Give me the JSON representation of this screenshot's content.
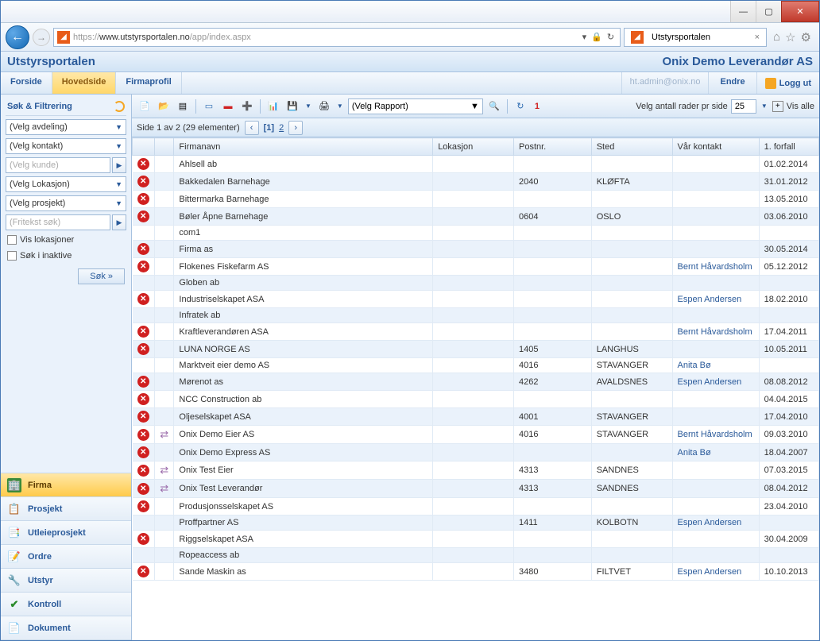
{
  "window": {
    "url_prefix": "https://",
    "url_host": "www.utstyrsportalen.no",
    "url_path": "/app/index.aspx",
    "tab_title": "Utstyrsportalen"
  },
  "header": {
    "app_title": "Utstyrsportalen",
    "company": "Onix Demo Leverandør AS"
  },
  "menu": {
    "items": [
      "Forside",
      "Hovedside",
      "Firmaprofil"
    ],
    "active_index": 1,
    "user_email": "ht.admin@onix.no",
    "endre": "Endre",
    "logout": "Logg ut"
  },
  "filter": {
    "title": "Søk & Filtrering",
    "avdeling": "(Velg avdeling)",
    "kontakt": "(Velg kontakt)",
    "kunde": "(Velg kunde)",
    "lokasjon": "(Velg Lokasjon)",
    "prosjekt": "(Velg prosjekt)",
    "fritekst": "(Fritekst søk)",
    "vis_lokasjoner": "Vis lokasjoner",
    "sok_inaktive": "Søk i inaktive",
    "sok_btn": "Søk »"
  },
  "nav": {
    "items": [
      {
        "label": "Firma",
        "icon": "🏢",
        "cls": "ico-firma"
      },
      {
        "label": "Prosjekt",
        "icon": "📋",
        "cls": "ico-blue"
      },
      {
        "label": "Utleieprosjekt",
        "icon": "📑",
        "cls": "ico-blue"
      },
      {
        "label": "Ordre",
        "icon": "📝",
        "cls": "ico-blue"
      },
      {
        "label": "Utstyr",
        "icon": "🔧",
        "cls": "ico-green"
      },
      {
        "label": "Kontroll",
        "icon": "✔",
        "cls": "ico-green"
      },
      {
        "label": "Dokument",
        "icon": "📄",
        "cls": "ico-blue"
      }
    ],
    "active_index": 0
  },
  "toolbar": {
    "report_placeholder": "(Velg Rapport)",
    "count": "1",
    "rows_label": "Velg antall rader pr side",
    "rows_value": "25",
    "vis_alle": "Vis alle"
  },
  "pager": {
    "summary": "Side 1 av 2 (29 elementer)",
    "current": "[1]",
    "next": "2"
  },
  "columns": {
    "firmanavn": "Firmanavn",
    "lokasjon": "Lokasjon",
    "postnr": "Postnr.",
    "sted": "Sted",
    "kontakt": "Vår kontakt",
    "forfall": "1. forfall"
  },
  "rows": [
    {
      "del": true,
      "swap": false,
      "name": "Ahlsell ab",
      "lok": "",
      "post": "",
      "sted": "",
      "kontakt": "",
      "forfall": "01.02.2014"
    },
    {
      "del": true,
      "swap": false,
      "name": "Bakkedalen Barnehage",
      "lok": "",
      "post": "2040",
      "sted": "KLØFTA",
      "kontakt": "",
      "forfall": "31.01.2012"
    },
    {
      "del": true,
      "swap": false,
      "name": "Bittermarka Barnehage",
      "lok": "",
      "post": "",
      "sted": "",
      "kontakt": "",
      "forfall": "13.05.2010"
    },
    {
      "del": true,
      "swap": false,
      "name": "Bøler Åpne Barnehage",
      "lok": "",
      "post": "0604",
      "sted": "OSLO",
      "kontakt": "",
      "forfall": "03.06.2010"
    },
    {
      "del": false,
      "swap": false,
      "name": "com1",
      "lok": "",
      "post": "",
      "sted": "",
      "kontakt": "",
      "forfall": ""
    },
    {
      "del": true,
      "swap": false,
      "name": "Firma as",
      "lok": "",
      "post": "",
      "sted": "",
      "kontakt": "",
      "forfall": "30.05.2014"
    },
    {
      "del": true,
      "swap": false,
      "name": "Flokenes Fiskefarm AS",
      "lok": "",
      "post": "",
      "sted": "",
      "kontakt": "Bernt Håvardsholm",
      "forfall": "05.12.2012"
    },
    {
      "del": false,
      "swap": false,
      "name": "Globen ab",
      "lok": "",
      "post": "",
      "sted": "",
      "kontakt": "",
      "forfall": ""
    },
    {
      "del": true,
      "swap": false,
      "name": "Industriselskapet ASA",
      "lok": "",
      "post": "",
      "sted": "",
      "kontakt": "Espen Andersen",
      "forfall": "18.02.2010"
    },
    {
      "del": false,
      "swap": false,
      "name": "Infratek ab",
      "lok": "",
      "post": "",
      "sted": "",
      "kontakt": "",
      "forfall": ""
    },
    {
      "del": true,
      "swap": false,
      "name": "Kraftleverandøren ASA",
      "lok": "",
      "post": "",
      "sted": "",
      "kontakt": "Bernt Håvardsholm",
      "forfall": "17.04.2011"
    },
    {
      "del": true,
      "swap": false,
      "name": "LUNA NORGE AS",
      "lok": "",
      "post": "1405",
      "sted": "LANGHUS",
      "kontakt": "",
      "forfall": "10.05.2011"
    },
    {
      "del": false,
      "swap": false,
      "name": "Marktveit eier demo AS",
      "lok": "",
      "post": "4016",
      "sted": "STAVANGER",
      "kontakt": "Anita Bø",
      "forfall": ""
    },
    {
      "del": true,
      "swap": false,
      "name": "Mørenot as",
      "lok": "",
      "post": "4262",
      "sted": "AVALDSNES",
      "kontakt": "Espen Andersen",
      "forfall": "08.08.2012"
    },
    {
      "del": true,
      "swap": false,
      "name": "NCC Construction ab",
      "lok": "",
      "post": "",
      "sted": "",
      "kontakt": "",
      "forfall": "04.04.2015"
    },
    {
      "del": true,
      "swap": false,
      "name": "Oljeselskapet ASA",
      "lok": "",
      "post": "4001",
      "sted": "STAVANGER",
      "kontakt": "",
      "forfall": "17.04.2010"
    },
    {
      "del": true,
      "swap": true,
      "name": "Onix Demo Eier AS",
      "lok": "",
      "post": "4016",
      "sted": "STAVANGER",
      "kontakt": "Bernt Håvardsholm",
      "forfall": "09.03.2010"
    },
    {
      "del": true,
      "swap": false,
      "name": "Onix Demo Express AS",
      "lok": "",
      "post": "",
      "sted": "",
      "kontakt": "Anita Bø",
      "forfall": "18.04.2007"
    },
    {
      "del": true,
      "swap": true,
      "name": "Onix Test Eier",
      "lok": "",
      "post": "4313",
      "sted": "SANDNES",
      "kontakt": "",
      "forfall": "07.03.2015"
    },
    {
      "del": true,
      "swap": true,
      "name": "Onix Test Leverandør",
      "lok": "",
      "post": "4313",
      "sted": "SANDNES",
      "kontakt": "",
      "forfall": "08.04.2012"
    },
    {
      "del": true,
      "swap": false,
      "name": "Produsjonsselskapet AS",
      "lok": "",
      "post": "",
      "sted": "",
      "kontakt": "",
      "forfall": "23.04.2010"
    },
    {
      "del": false,
      "swap": false,
      "name": "Proffpartner AS",
      "lok": "",
      "post": "1411",
      "sted": "KOLBOTN",
      "kontakt": "Espen Andersen",
      "forfall": ""
    },
    {
      "del": true,
      "swap": false,
      "name": "Riggselskapet ASA",
      "lok": "",
      "post": "",
      "sted": "",
      "kontakt": "",
      "forfall": "30.04.2009"
    },
    {
      "del": false,
      "swap": false,
      "name": "Ropeaccess ab",
      "lok": "",
      "post": "",
      "sted": "",
      "kontakt": "",
      "forfall": ""
    },
    {
      "del": true,
      "swap": false,
      "name": "Sande Maskin as",
      "lok": "",
      "post": "3480",
      "sted": "FILTVET",
      "kontakt": "Espen Andersen",
      "forfall": "10.10.2013"
    }
  ]
}
